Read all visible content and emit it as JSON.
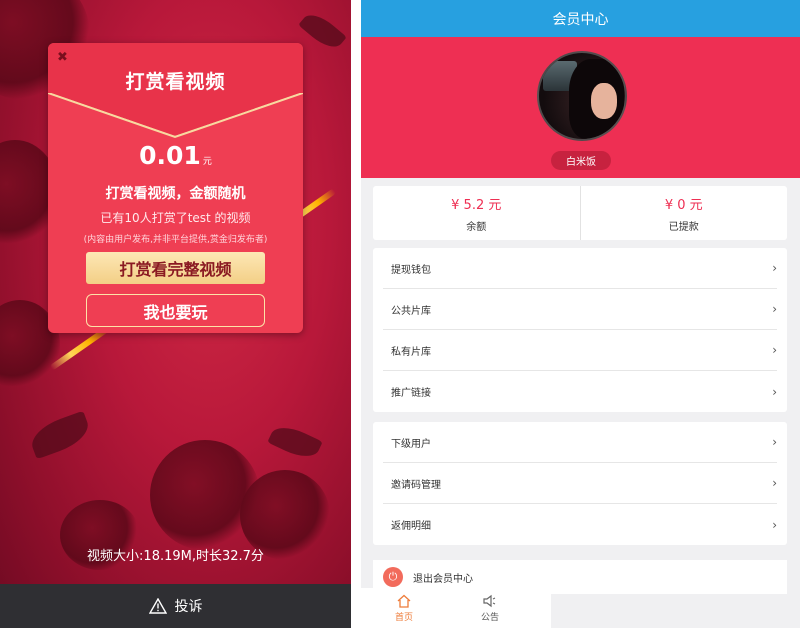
{
  "left": {
    "close_icon_glyph": "✖",
    "card_title": "打赏看视频",
    "amount_value": "0.01",
    "amount_unit": "元",
    "subtitle": "打赏看视频，金额随机",
    "tip_text": "已有10人打赏了test 的视频",
    "notice_text": "(内容由用户发布,并非平台提供,赏金归发布者)",
    "reward_button": "打赏看完整视频",
    "play_button": "我也要玩",
    "video_info": "视频大小:18.19M,时长32.7分",
    "complain_label": "投诉",
    "colors": {
      "card": "#ef3e53",
      "gold": "#f3cf86",
      "background": "#b8183a",
      "bottom_bar": "#2f2f33"
    }
  },
  "right": {
    "header_title": "会员中心",
    "level_badge": "白米饭",
    "balance": {
      "value": "¥ 5.2 元",
      "label": "余额"
    },
    "withdrawn": {
      "value": "¥ 0 元",
      "label": "已提款"
    },
    "menu_group_1": [
      {
        "label": "提现钱包"
      },
      {
        "label": "公共片库"
      },
      {
        "label": "私有片库"
      },
      {
        "label": "推广链接"
      }
    ],
    "menu_group_2": [
      {
        "label": "下级用户"
      },
      {
        "label": "邀请码管理"
      },
      {
        "label": "返佣明细"
      }
    ],
    "logout_label": "退出会员中心",
    "tabs": [
      {
        "label": "首页",
        "icon": "home-icon",
        "active": true
      },
      {
        "label": "公告",
        "icon": "speaker-icon",
        "active": false
      }
    ],
    "colors": {
      "header": "#27a0e0",
      "hero": "#ee2f53",
      "accent": "#ee2f53",
      "active_tab": "#ee7c3a"
    }
  }
}
